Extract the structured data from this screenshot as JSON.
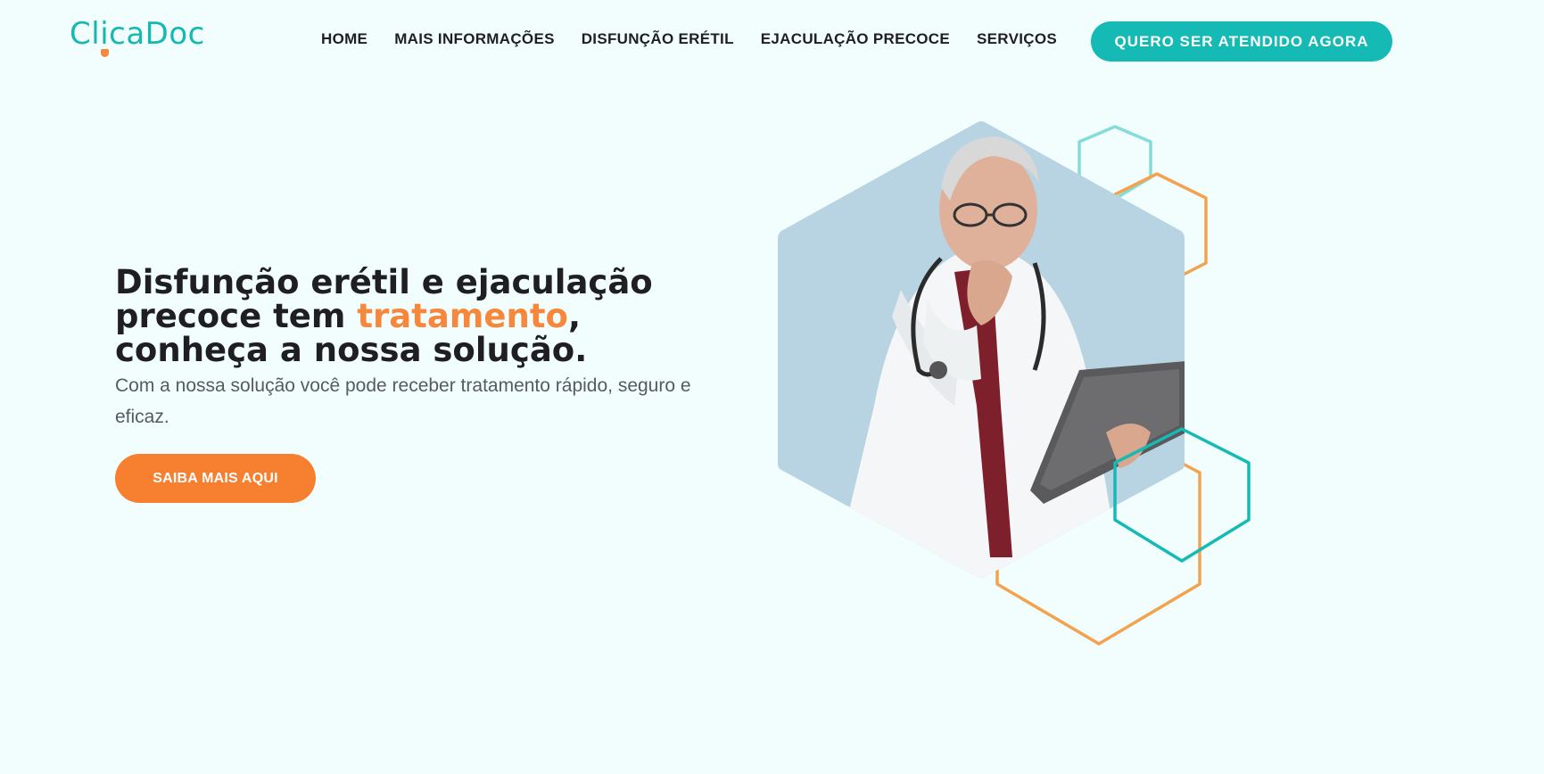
{
  "brand": {
    "logo_text_1": "Cl",
    "logo_text_i": "i",
    "logo_text_2": "caDoc",
    "primary_color": "#14bab3",
    "accent_color": "#f7883b"
  },
  "nav": {
    "items": [
      {
        "label": "HOME"
      },
      {
        "label": "MAIS INFORMAÇÕES"
      },
      {
        "label": "DISFUNÇÃO ERÉTIL"
      },
      {
        "label": "EJACULAÇÃO PRECOCE"
      },
      {
        "label": "SERVIÇOS"
      }
    ],
    "cta_label": "QUERO SER ATENDIDO AGORA"
  },
  "hero": {
    "title_part1": "Disfunção erétil e ejaculação precoce tem ",
    "title_accent": "tratamento",
    "title_part2": ", conheça a nossa solução.",
    "subtitle": "Com a nossa solução você pode receber tratamento rápido, seguro e eficaz.",
    "cta_label": "SAIBA MAIS AQUI"
  },
  "icons": {
    "hero_image": "doctor-with-tablet-image",
    "decor": "hexagon-outline-icon"
  }
}
